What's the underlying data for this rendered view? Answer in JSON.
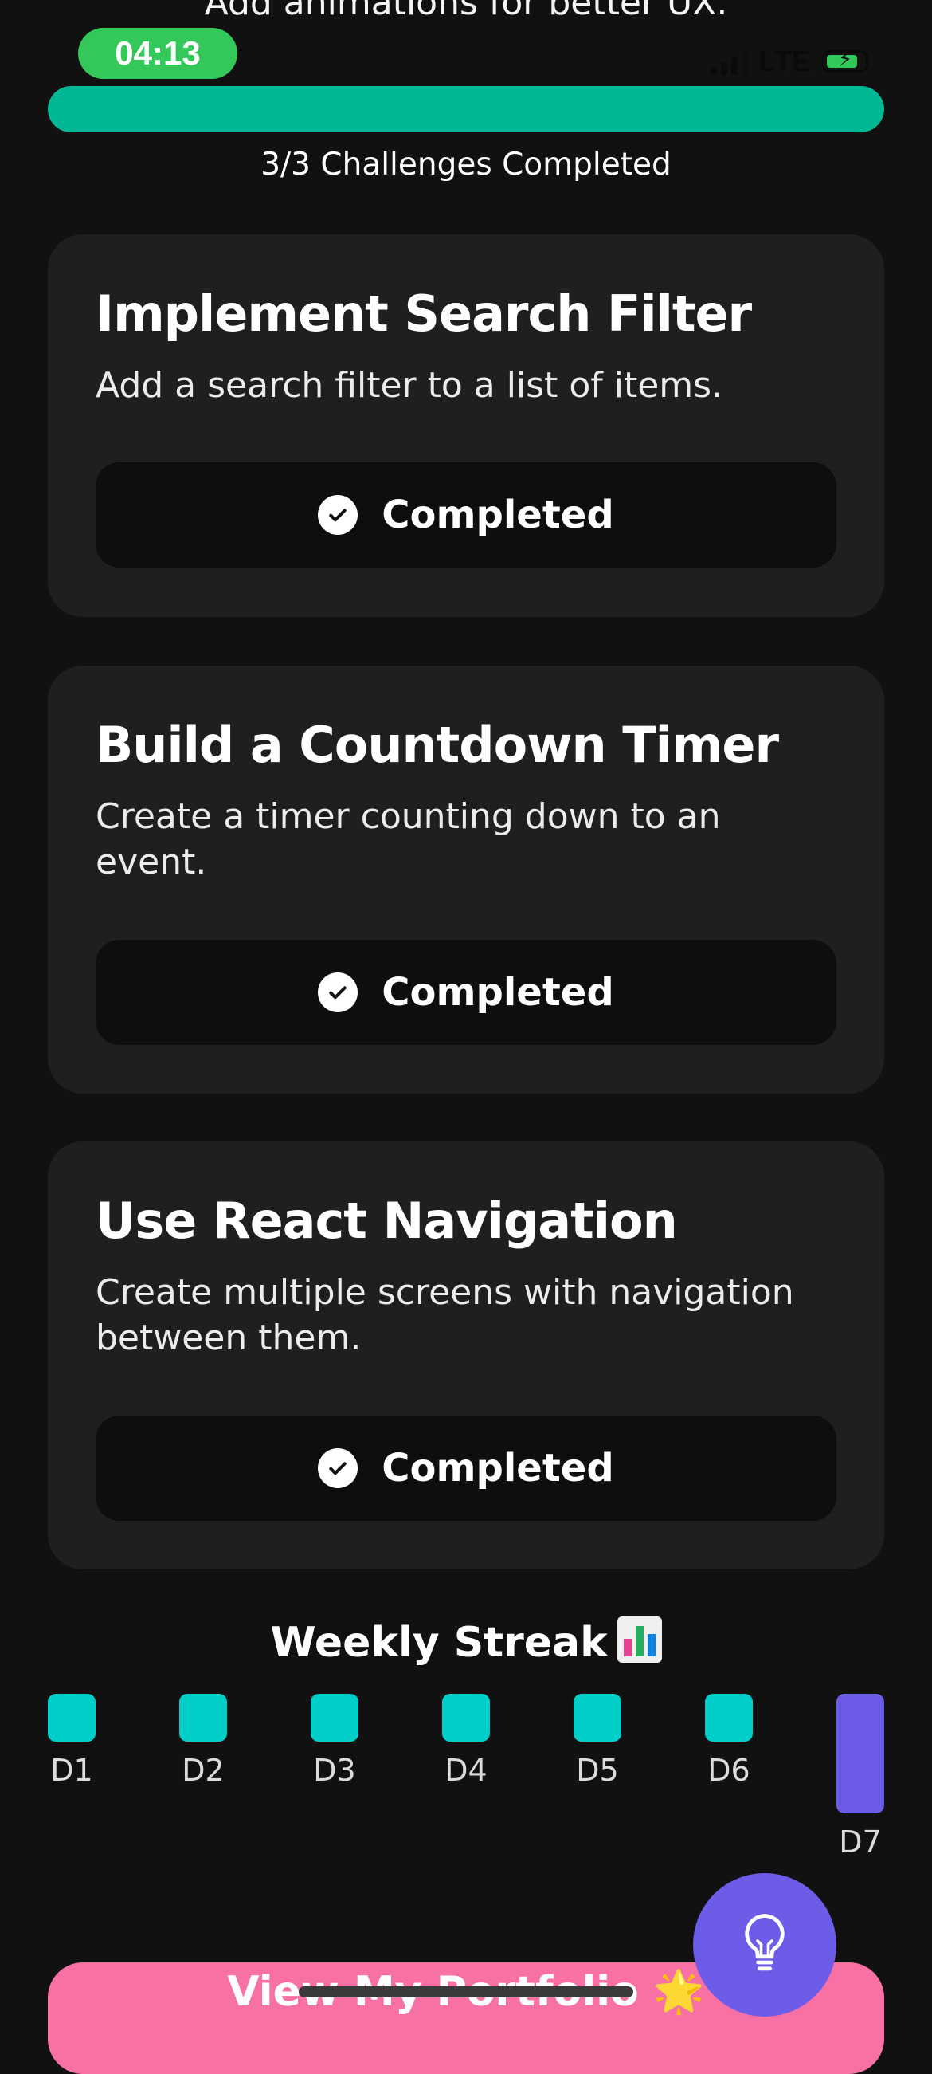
{
  "status_bar": {
    "time": "04:13",
    "network": "LTE"
  },
  "scrolled_text": "Add animations for better UX.",
  "progress": {
    "completed": 3,
    "total": 3,
    "label": "3/3 Challenges Completed",
    "fill_color": "#00b894"
  },
  "challenges": [
    {
      "title": "Implement Search Filter",
      "description": "Add a search filter to a list of items.",
      "status": "Completed"
    },
    {
      "title": "Build a Countdown Timer",
      "description": "Create a timer counting down to an event.",
      "status": "Completed"
    },
    {
      "title": "Use React Navigation",
      "description": "Create multiple screens with navigation between them.",
      "status": "Completed"
    }
  ],
  "streak": {
    "title": "Weekly Streak",
    "icon": "bar-chart-icon",
    "days": [
      {
        "label": "D1",
        "today": false
      },
      {
        "label": "D2",
        "today": false
      },
      {
        "label": "D3",
        "today": false
      },
      {
        "label": "D4",
        "today": false
      },
      {
        "label": "D5",
        "today": false
      },
      {
        "label": "D6",
        "today": false
      },
      {
        "label": "D7",
        "today": true
      }
    ],
    "done_color": "#00cec9",
    "today_color": "#6c5ce7"
  },
  "fab": {
    "icon": "lightbulb-icon",
    "color": "#6c5ce7"
  },
  "portfolio_button": {
    "label": "View My Portfolio 🌟",
    "color": "#f871a4"
  }
}
